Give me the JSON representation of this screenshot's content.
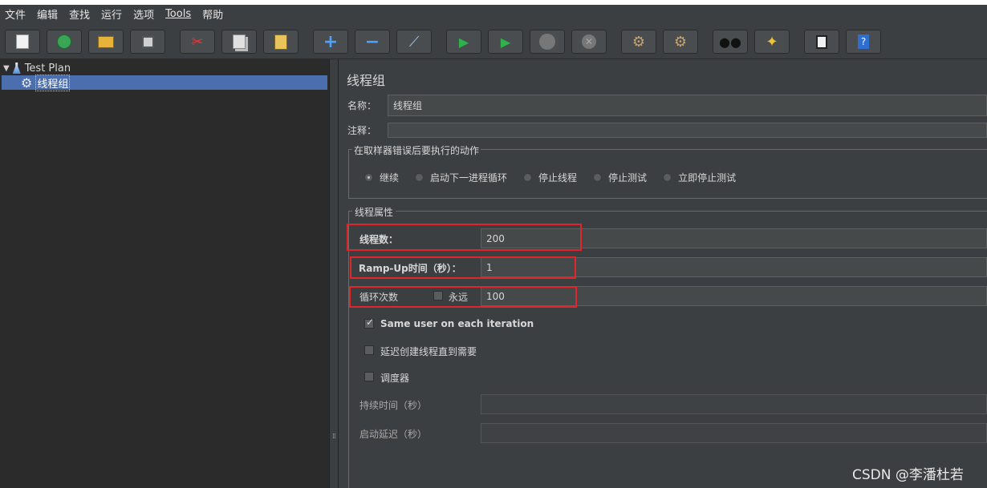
{
  "menu": [
    "文件",
    "编辑",
    "查找",
    "运行",
    "选项",
    "Tools",
    "帮助"
  ],
  "toolbar_icons": [
    "new-icon",
    "templates-icon",
    "open-icon",
    "save-icon",
    "cut-icon",
    "copy-icon",
    "paste-icon",
    "expand-icon",
    "collapse-icon",
    "toggle-icon",
    "start-icon",
    "start-no-pause-icon",
    "stop-icon",
    "shutdown-icon",
    "clear-icon",
    "clear-all-icon",
    "search-icon",
    "reset-search-icon",
    "function-helper-icon",
    "help-icon"
  ],
  "tree": {
    "root_label": "Test Plan",
    "child_label": "线程组"
  },
  "panel": {
    "title": "线程组",
    "name_label": "名称：",
    "name_value": "线程组",
    "comment_label": "注释：",
    "comment_value": "",
    "error_action": {
      "legend": "在取样器错误后要执行的动作",
      "options": [
        "继续",
        "启动下一进程循环",
        "停止线程",
        "停止测试",
        "立即停止测试"
      ],
      "selected": "继续"
    },
    "thread_props": {
      "legend": "线程属性",
      "threads_label": "线程数：",
      "threads_value": "200",
      "rampup_label": "Ramp-Up时间（秒）：",
      "rampup_value": "1",
      "loop_label": "循环次数",
      "forever_label": "永远",
      "forever_checked": false,
      "loop_value": "100",
      "same_user_label": "Same user on each iteration",
      "same_user_checked": true,
      "delay_label": "延迟创建线程直到需要",
      "delay_checked": false,
      "scheduler_label": "调度器",
      "scheduler_checked": false,
      "duration_label": "持续时间（秒）",
      "duration_value": "",
      "startup_delay_label": "启动延迟（秒）",
      "startup_delay_value": ""
    }
  },
  "watermark": "CSDN @李潘杜若"
}
